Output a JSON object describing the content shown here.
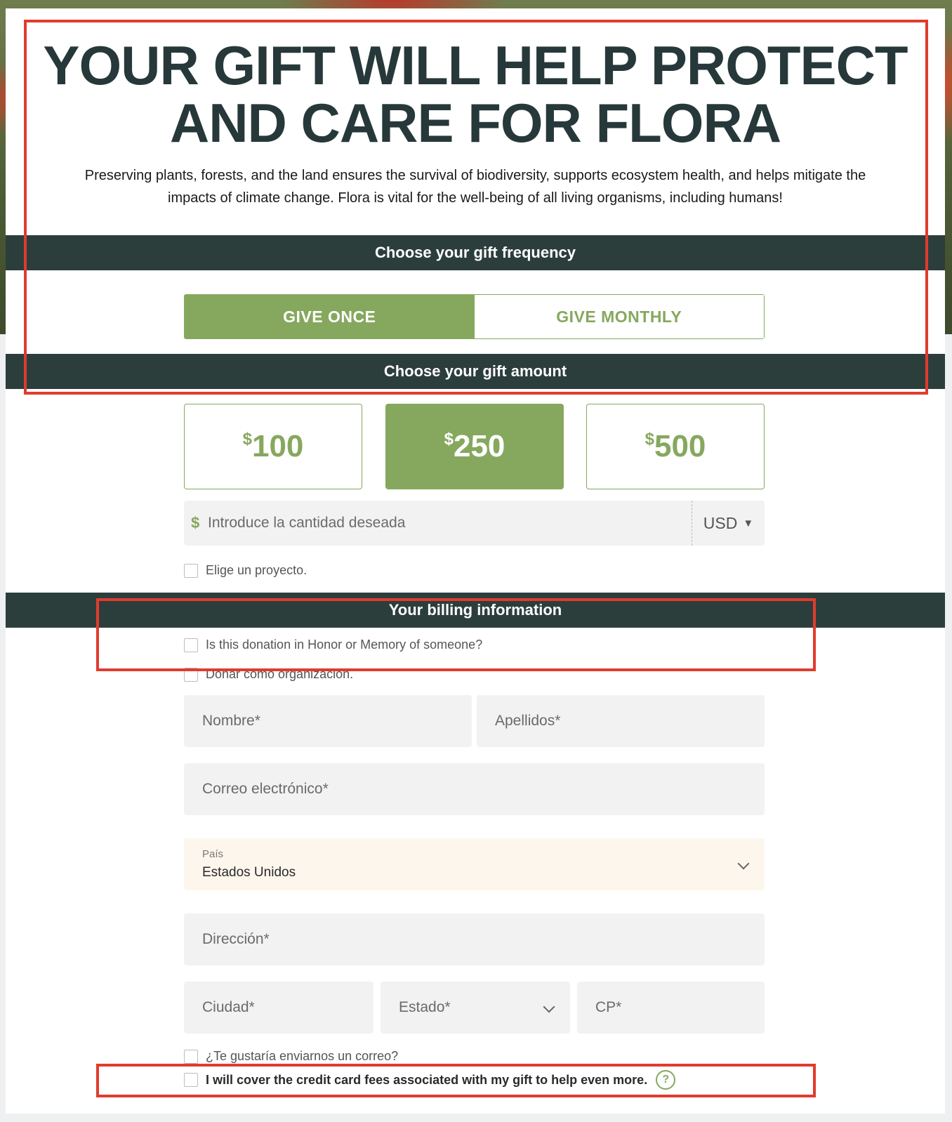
{
  "hero": {
    "title_line1": "YOUR GIFT WILL HELP PROTECT",
    "title_line2": "AND CARE FOR FLORA",
    "description": "Preserving plants, forests, and the land ensures the survival of  biodiversity, supports ecosystem health, and helps mitigate the impacts of climate change. Flora is vital for the well-being of all living organisms, including humans!"
  },
  "frequency": {
    "heading": "Choose your gift frequency",
    "options": [
      {
        "label": "GIVE ONCE",
        "selected": true
      },
      {
        "label": "GIVE MONTHLY",
        "selected": false
      }
    ]
  },
  "amount": {
    "heading": "Choose your gift amount",
    "currency_symbol": "$",
    "options": [
      {
        "value": "100",
        "selected": false
      },
      {
        "value": "250",
        "selected": true
      },
      {
        "value": "500",
        "selected": false
      }
    ],
    "custom_placeholder": "Introduce la cantidad deseada",
    "custom_prefix": "$",
    "currency": "USD",
    "caret": "▼",
    "project_label": "Elige un proyecto."
  },
  "billing": {
    "heading": "Your billing information",
    "honor_label": "Is this donation in Honor or Memory of someone?",
    "org_label": "Donar como organización.",
    "first_name_placeholder": "Nombre*",
    "last_name_placeholder": "Apellidos*",
    "email_placeholder": "Correo electrónico*",
    "country_label": "País",
    "country_value": "Estados Unidos",
    "address_placeholder": "Dirección*",
    "city_placeholder": "Ciudad*",
    "state_placeholder": "Estado*",
    "zip_placeholder": "CP*",
    "email_optin_label": "¿Te gustaría enviarnos un correo?",
    "cover_fees_label": "I will cover the credit card fees associated with my gift to help even more.",
    "help_glyph": "?"
  },
  "colors": {
    "accent_green": "#86a85e",
    "band_dark": "#2c3e3c",
    "title_dark": "#27383a",
    "highlight_red": "#e03c2e"
  },
  "icons": [
    "dollar-icon",
    "caret-down-icon",
    "chevron-down-icon",
    "help-icon"
  ]
}
